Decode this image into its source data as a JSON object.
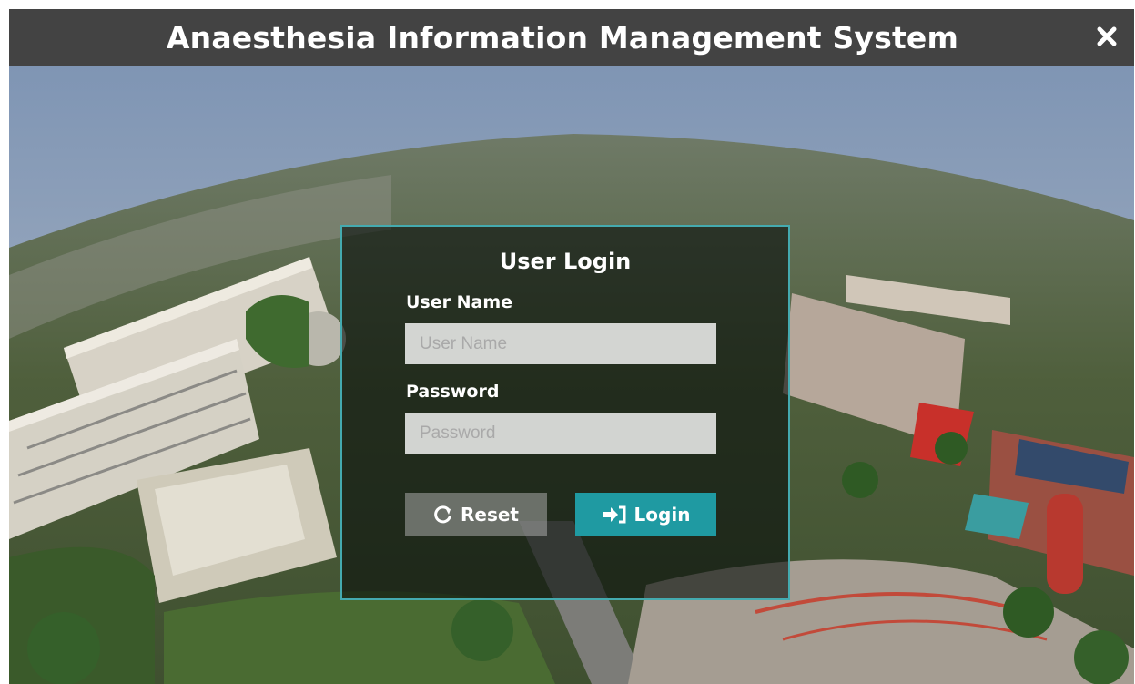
{
  "window": {
    "title": "Anaesthesia Information Management System",
    "close_icon": "close-icon"
  },
  "background": {
    "description_icon": "aerial-campus-photo"
  },
  "login": {
    "heading": "User Login",
    "username_label": "User Name",
    "username_placeholder": "User Name",
    "username_value": "",
    "password_label": "Password",
    "password_placeholder": "Password",
    "password_value": "",
    "reset_label": "Reset",
    "reset_icon": "refresh-icon",
    "login_label": "Login",
    "login_icon": "sign-in-icon"
  },
  "colors": {
    "titlebar": "#434343",
    "card_border": "#44aaaf",
    "login_button": "#1f9aa2"
  }
}
